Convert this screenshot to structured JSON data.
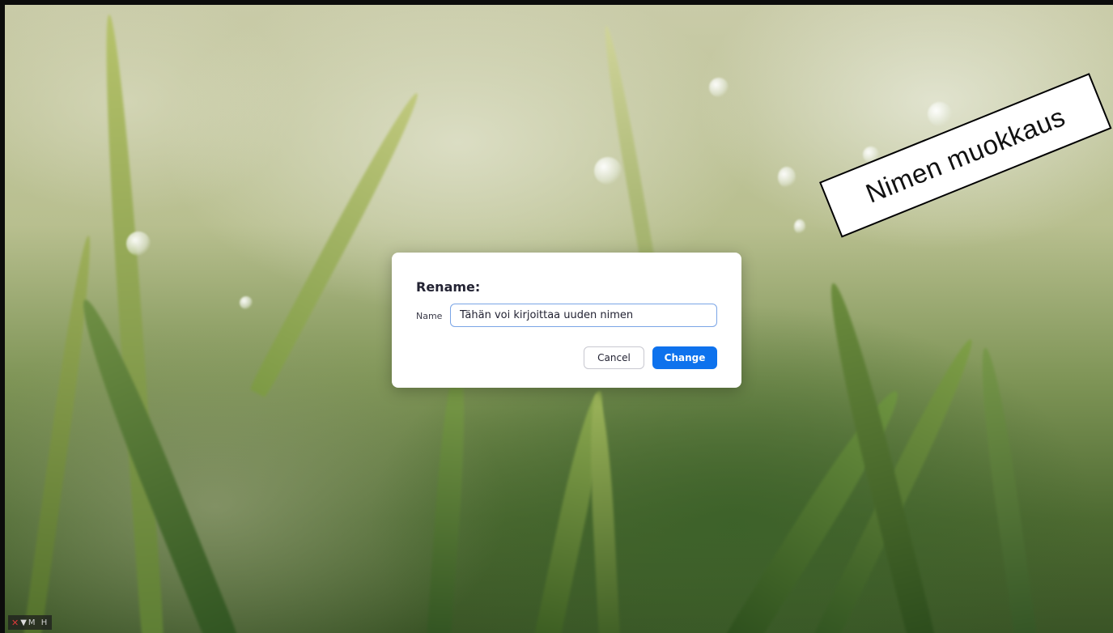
{
  "dialog": {
    "title": "Rename:",
    "field_label": "Name",
    "input_value": "Tähän voi kirjoittaa uuden nimen",
    "cancel_label": "Cancel",
    "change_label": "Change"
  },
  "annotation": {
    "text": "Nimen muokkaus"
  },
  "status": {
    "initials": "M H",
    "icons": [
      "muted-mic-icon",
      "pin-icon"
    ]
  },
  "colors": {
    "primary": "#0e72ed",
    "input_border": "#7aa5e6",
    "muted_icon": "#d93a3a"
  }
}
